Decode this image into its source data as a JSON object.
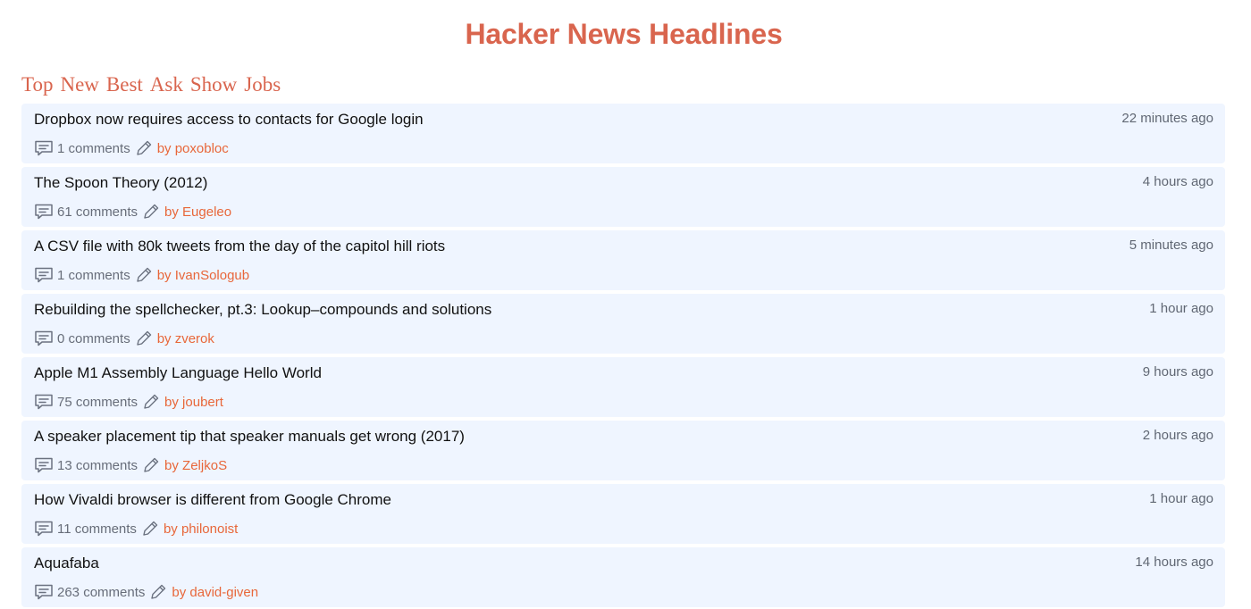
{
  "header": {
    "title": "Hacker News Headlines"
  },
  "tabs": [
    "Top",
    "New",
    "Best",
    "Ask",
    "Show",
    "Jobs"
  ],
  "colors": {
    "accent": "#d9654e",
    "author": "#e8673a",
    "card": "#eff5ff"
  },
  "stories": [
    {
      "title": "Dropbox now requires access to contacts for Google login",
      "time": "22 minutes ago",
      "comments": "1 comments",
      "author": "by poxobloc"
    },
    {
      "title": "The Spoon Theory (2012)",
      "time": "4 hours ago",
      "comments": "61 comments",
      "author": "by Eugeleo"
    },
    {
      "title": "A CSV file with 80k tweets from the day of the capitol hill riots",
      "time": "5 minutes ago",
      "comments": "1 comments",
      "author": "by IvanSologub"
    },
    {
      "title": "Rebuilding the spellchecker, pt.3: Lookup–compounds and solutions",
      "time": "1 hour ago",
      "comments": "0 comments",
      "author": "by zverok"
    },
    {
      "title": "Apple M1 Assembly Language Hello World",
      "time": "9 hours ago",
      "comments": "75 comments",
      "author": "by joubert"
    },
    {
      "title": "A speaker placement tip that speaker manuals get wrong (2017)",
      "time": "2 hours ago",
      "comments": "13 comments",
      "author": "by ZeljkoS"
    },
    {
      "title": "How Vivaldi browser is different from Google Chrome",
      "time": "1 hour ago",
      "comments": "11 comments",
      "author": "by philonoist"
    },
    {
      "title": "Aquafaba",
      "time": "14 hours ago",
      "comments": "263 comments",
      "author": "by david-given"
    }
  ],
  "icons": {
    "comments": "comment-icon",
    "author": "pencil-icon"
  }
}
